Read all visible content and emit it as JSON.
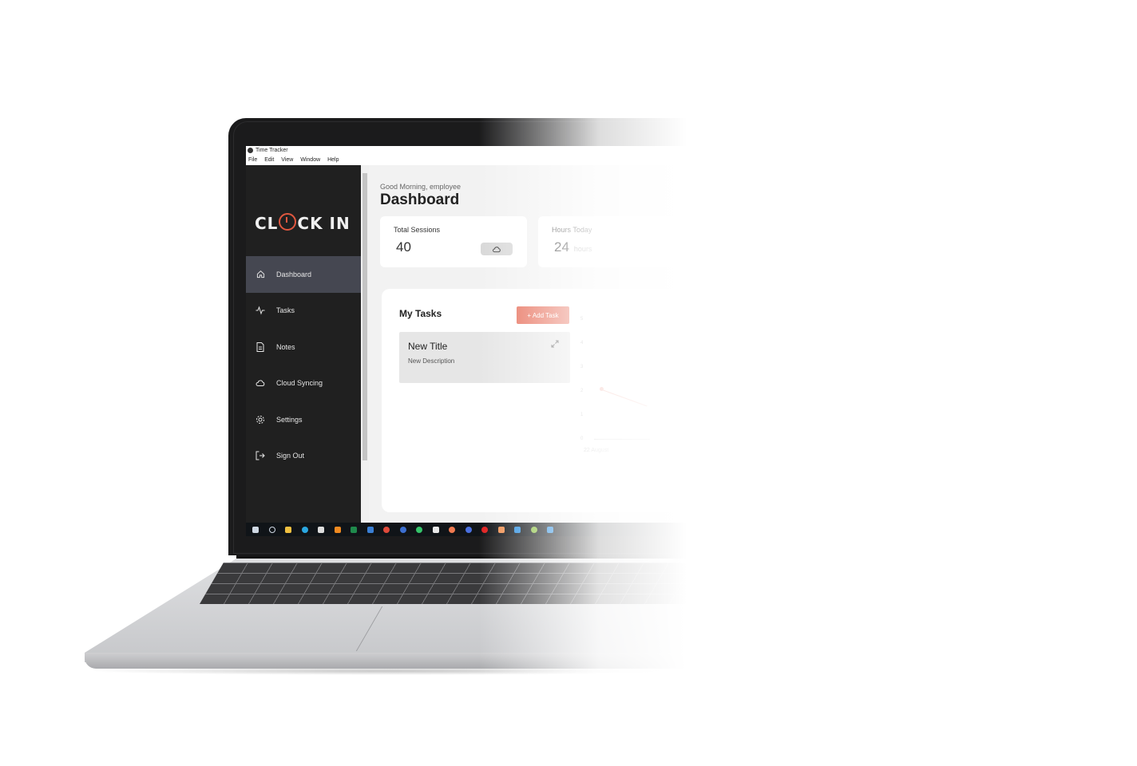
{
  "window": {
    "title": "Time Tracker",
    "menu": [
      "File",
      "Edit",
      "View",
      "Window",
      "Help"
    ]
  },
  "sidebar": {
    "logo": {
      "left": "CL",
      "right": "CK IN"
    },
    "items": [
      {
        "label": "Dashboard",
        "icon": "home-icon",
        "active": true
      },
      {
        "label": "Tasks",
        "icon": "activity-icon",
        "active": false
      },
      {
        "label": "Notes",
        "icon": "document-icon",
        "active": false
      },
      {
        "label": "Cloud Syncing",
        "icon": "cloud-icon",
        "active": false
      },
      {
        "label": "Settings",
        "icon": "gear-icon",
        "active": false
      },
      {
        "label": "Sign Out",
        "icon": "sign-out-icon",
        "active": false
      }
    ]
  },
  "header": {
    "greeting": "Good Morning, employee",
    "title": "Dashboard"
  },
  "stats": [
    {
      "label": "Total Sessions",
      "value": "40",
      "unit": "",
      "icon": "cloud-icon"
    },
    {
      "label": "Hours Today",
      "value": "24",
      "unit": "hours"
    }
  ],
  "tasks": {
    "title": "My Tasks",
    "add_label": "+ Add Task",
    "items": [
      {
        "title": "New Title",
        "description": "New Description"
      }
    ]
  },
  "chart": {
    "y_ticks": [
      "5",
      "4",
      "3",
      "2",
      "1",
      "0"
    ],
    "x_label": "22 August"
  },
  "taskbar": {
    "icons": [
      "windows-start-icon",
      "search-icon",
      "file-explorer-icon",
      "edge-icon",
      "store-icon",
      "vlc-icon",
      "excel-icon",
      "mail-icon",
      "chrome-icon",
      "app-icon",
      "whatsapp-icon",
      "notepad-icon",
      "app-icon",
      "firefox-icon",
      "opera-icon",
      "app-icon",
      "vscode-icon",
      "app-icon",
      "app-icon"
    ]
  },
  "colors": {
    "accent": "#e66a55",
    "sidebar": "#202020",
    "sidebar_active": "#454751"
  }
}
